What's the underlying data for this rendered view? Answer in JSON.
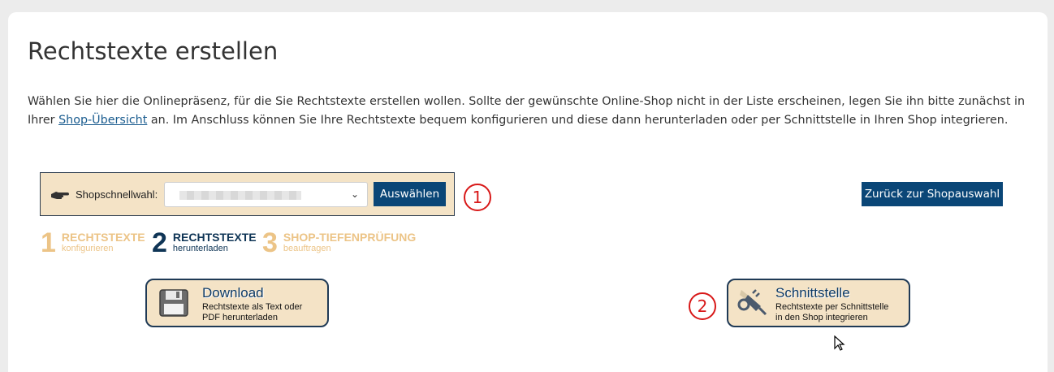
{
  "page": {
    "title": "Rechtstexte erstellen",
    "intro_text_1": "Wählen Sie hier die Onlinepräsenz, für die Sie Rechtstexte erstellen wollen. Sollte der gewünschte Online-Shop nicht in der Liste erscheinen, legen Sie ihn bitte zunächst in Ihrer ",
    "intro_link": "Shop-Übersicht",
    "intro_text_2": " an. Im Anschluss können Sie Ihre Rechtstexte bequem konfigurieren und diese dann herunterladen oder per Schnittstelle in Ihren Shop integrieren."
  },
  "shop_selector": {
    "label": "Shopschnellwahl:",
    "select_button": "Auswählen",
    "marker": "1"
  },
  "back_button": "Zurück zur Shopauswahl",
  "steps": [
    {
      "number": "1",
      "title": "RECHTSTEXTE",
      "subtitle": "konfigurieren"
    },
    {
      "number": "2",
      "title": "RECHTSTEXTE",
      "subtitle": "herunterladen"
    },
    {
      "number": "3",
      "title": "SHOP-TIEFENPRÜFUNG",
      "subtitle": "beauftragen"
    }
  ],
  "actions": {
    "download": {
      "title": "Download",
      "desc_line1": "Rechtstexte als Text oder",
      "desc_line2": "PDF herunterladen"
    },
    "interface": {
      "title": "Schnittstelle",
      "desc_line1": "Rechtstexte per Schnittstelle",
      "desc_line2": "in den Shop integrieren",
      "marker": "2"
    }
  },
  "colors": {
    "accent": "#0a4677",
    "panel": "#f4e3c6",
    "marker": "#d81818",
    "step_faded": "#ecc487"
  }
}
